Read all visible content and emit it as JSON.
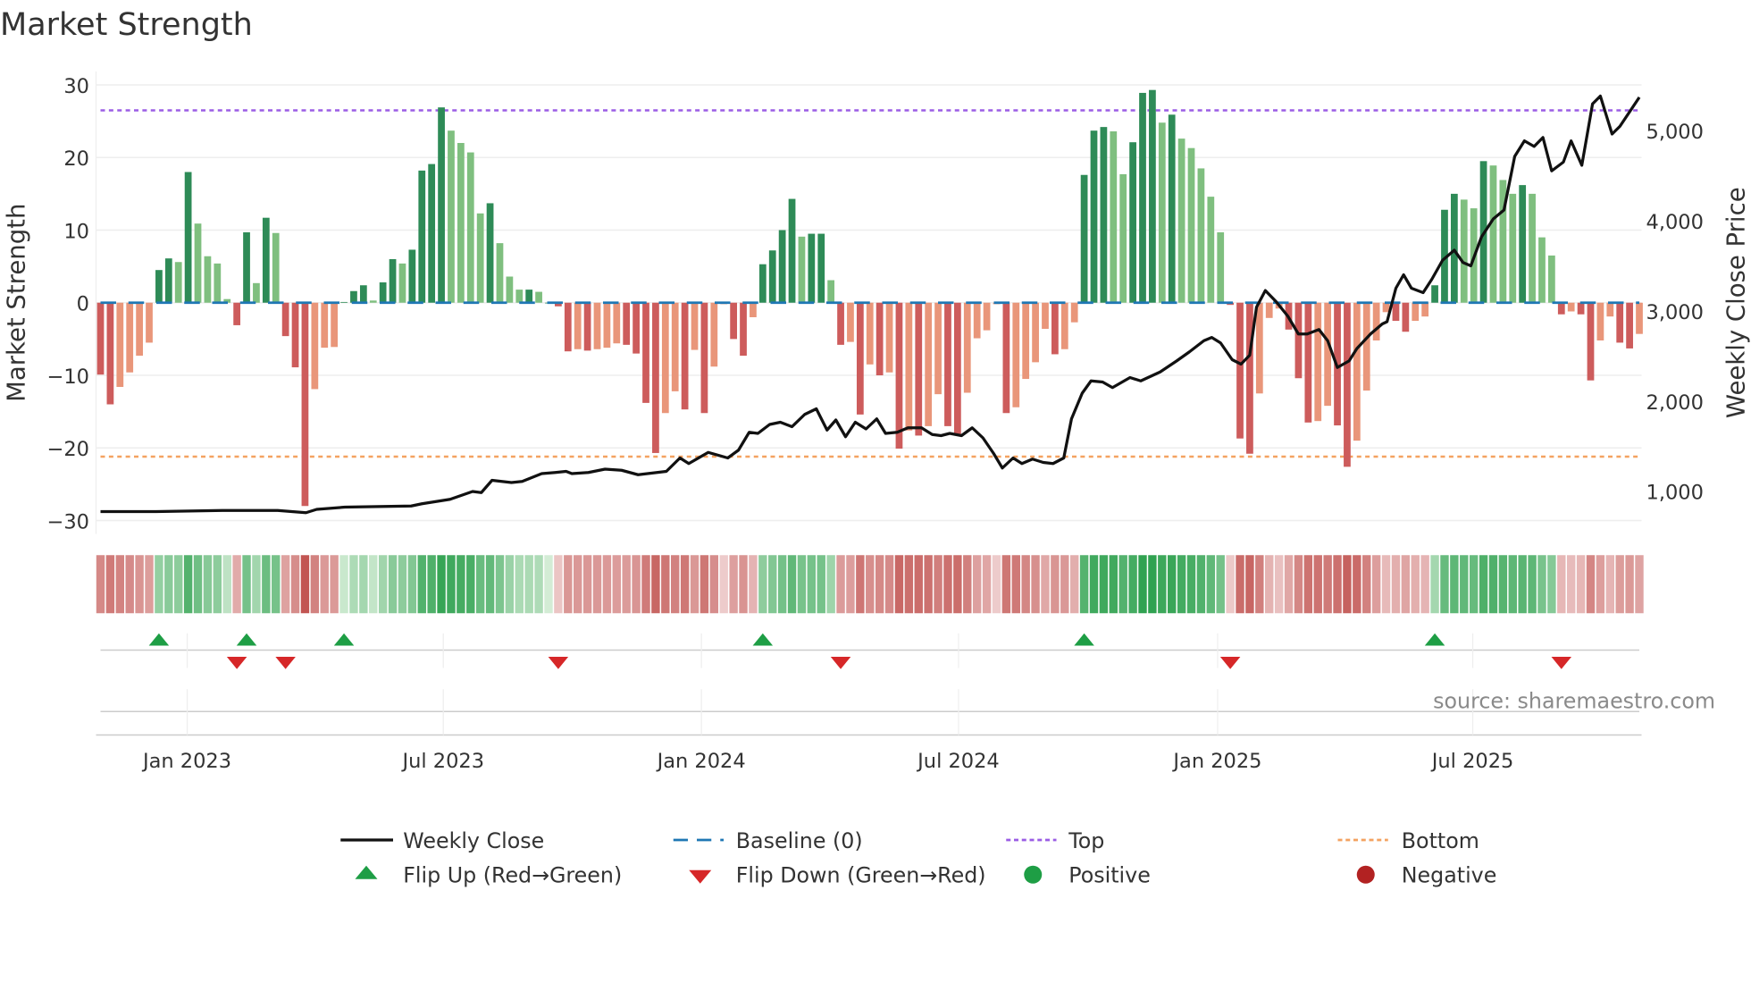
{
  "title": "Market Strength",
  "source": "source: sharemaestro.com",
  "colors": {
    "pos_strong": "#2e8b57",
    "pos_weak": "#7fbf7f",
    "neg_strong": "#cd5c5c",
    "neg_weak": "#e9967a",
    "line": "#111111",
    "baseline": "#1f77b4",
    "top": "#9b5de5",
    "bottom": "#f4a261",
    "flip_up": "#1e9e45",
    "flip_down": "#d62728",
    "positive": "#1e9e45",
    "negative": "#b22222"
  },
  "legend": {
    "weekly_close": "Weekly Close",
    "baseline": "Baseline (0)",
    "top": "Top",
    "bottom": "Bottom",
    "flip_up": "Flip Up (Red→Green)",
    "flip_down": "Flip Down (Green→Red)",
    "positive": "Positive",
    "negative": "Negative"
  },
  "chart_data": {
    "type": "bar",
    "title": "Market Strength",
    "ylabel": "Market Strength",
    "y2label": "Weekly Close Price",
    "ylim": [
      -30,
      30
    ],
    "y2lim": [
      678,
      5507
    ],
    "yticks": [
      "30",
      "20",
      "10",
      "0",
      "−10",
      "−20",
      "−30"
    ],
    "ytick_values": [
      30,
      20,
      10,
      0,
      -10,
      -20,
      -30
    ],
    "y2ticks": [
      "1,000",
      "2,000",
      "3,000",
      "4,000",
      "5,000"
    ],
    "y2tick_values": [
      1000,
      2000,
      3000,
      4000,
      5000
    ],
    "xticks": [
      {
        "label": "Jan 2023",
        "week": 8.9
      },
      {
        "label": "Jul 2023",
        "week": 35.2
      },
      {
        "label": "Jan 2024",
        "week": 61.7
      },
      {
        "label": "Jul 2024",
        "week": 88.1
      },
      {
        "label": "Jan 2025",
        "week": 114.7
      },
      {
        "label": "Jul 2025",
        "week": 140.9
      }
    ],
    "top_level": 26.5,
    "bottom_level": -21.2,
    "baseline": 0,
    "strength": [
      -9.9,
      -14,
      -11.6,
      -9.6,
      -7.3,
      -5.5,
      4.5,
      6.1,
      5.6,
      18,
      10.9,
      6.4,
      5.4,
      0.5,
      -3.1,
      9.7,
      2.7,
      11.7,
      9.6,
      -4.6,
      -8.9,
      -28,
      -11.9,
      -6.2,
      -6.1,
      0.1,
      1.6,
      2.4,
      0.3,
      2.8,
      6,
      5.4,
      7.3,
      18.2,
      19.1,
      26.9,
      23.7,
      22,
      20.7,
      12.3,
      13.7,
      8.2,
      3.6,
      1.8,
      1.8,
      1.5,
      0,
      -0.5,
      -6.7,
      -6.4,
      -6.6,
      -6.4,
      -6.2,
      -5.6,
      -5.8,
      -7,
      -13.8,
      -20.7,
      -15.2,
      -12.2,
      -14.7,
      -6.5,
      -15.2,
      -8.8,
      -0.2,
      -5,
      -7.3,
      -2,
      5.3,
      7.2,
      10,
      14.3,
      9.1,
      9.5,
      9.5,
      3.1,
      -5.8,
      -5.4,
      -15.4,
      -8.5,
      -10,
      -9.6,
      -20.1,
      -17.6,
      -18.3,
      -17,
      -12.6,
      -17,
      -18.2,
      -12.4,
      -4.9,
      -3.8,
      -0.2,
      -15.2,
      -14.4,
      -10.5,
      -8.2,
      -3.6,
      -7.1,
      -6.4,
      -2.7,
      17.6,
      23.7,
      24.2,
      23.6,
      17.7,
      22.1,
      28.9,
      29.3,
      24.8,
      25.9,
      22.6,
      21.3,
      18.5,
      14.6,
      9.7,
      -0.3,
      -18.7,
      -20.8,
      -12.5,
      -2.1,
      -0.8,
      -3.7,
      -10.4,
      -16.5,
      -16.3,
      -14.2,
      -16.9,
      -22.6,
      -19,
      -12.1,
      -5.2,
      -1.3,
      -2.5,
      -4,
      -2.5,
      -1.9,
      2.4,
      12.8,
      15,
      14.2,
      13,
      19.5,
      18.9,
      16.9,
      15,
      16.2,
      15,
      9,
      6.5,
      -1.6,
      -1.2,
      -1.6,
      -10.7,
      -5.2,
      -1.9,
      -5.5,
      -6.3,
      -4.3
    ],
    "weekly_close": [
      [
        0,
        777
      ],
      [
        5.7,
        777
      ],
      [
        12.5,
        790
      ],
      [
        18.2,
        790
      ],
      [
        21.1,
        765
      ],
      [
        22.2,
        802
      ],
      [
        25.1,
        827
      ],
      [
        31.9,
        839
      ],
      [
        33,
        864
      ],
      [
        35.9,
        913
      ],
      [
        38.2,
        1000
      ],
      [
        39.1,
        988
      ],
      [
        40.2,
        1124
      ],
      [
        42.2,
        1099
      ],
      [
        43.3,
        1111
      ],
      [
        45.3,
        1198
      ],
      [
        46.7,
        1210
      ],
      [
        47.8,
        1223
      ],
      [
        48.4,
        1198
      ],
      [
        50.1,
        1210
      ],
      [
        51.8,
        1248
      ],
      [
        53.5,
        1235
      ],
      [
        55.2,
        1186
      ],
      [
        58.1,
        1223
      ],
      [
        59.5,
        1371
      ],
      [
        60.4,
        1310
      ],
      [
        62.4,
        1433
      ],
      [
        64.4,
        1371
      ],
      [
        65.5,
        1458
      ],
      [
        66.6,
        1656
      ],
      [
        67.5,
        1644
      ],
      [
        68.7,
        1743
      ],
      [
        69.8,
        1768
      ],
      [
        71,
        1718
      ],
      [
        72.3,
        1854
      ],
      [
        73.5,
        1916
      ],
      [
        74.6,
        1681
      ],
      [
        75.5,
        1792
      ],
      [
        76.5,
        1607
      ],
      [
        77.5,
        1768
      ],
      [
        78.6,
        1693
      ],
      [
        79.7,
        1805
      ],
      [
        80.6,
        1644
      ],
      [
        81.8,
        1656
      ],
      [
        82.9,
        1706
      ],
      [
        84.3,
        1706
      ],
      [
        85.4,
        1631
      ],
      [
        86.3,
        1619
      ],
      [
        87.2,
        1644
      ],
      [
        88.4,
        1619
      ],
      [
        89.5,
        1706
      ],
      [
        90.6,
        1594
      ],
      [
        91.7,
        1421
      ],
      [
        92.6,
        1260
      ],
      [
        93.7,
        1371
      ],
      [
        94.6,
        1310
      ],
      [
        95.7,
        1359
      ],
      [
        96.8,
        1322
      ],
      [
        97.8,
        1310
      ],
      [
        98.9,
        1371
      ],
      [
        99.7,
        1805
      ],
      [
        100.8,
        2089
      ],
      [
        101.7,
        2226
      ],
      [
        102.9,
        2213
      ],
      [
        103.9,
        2151
      ],
      [
        105.7,
        2263
      ],
      [
        106.8,
        2226
      ],
      [
        108.8,
        2325
      ],
      [
        110.5,
        2448
      ],
      [
        111.8,
        2548
      ],
      [
        113.3,
        2671
      ],
      [
        114.1,
        2708
      ],
      [
        115,
        2647
      ],
      [
        116.2,
        2461
      ],
      [
        117.1,
        2411
      ],
      [
        118,
        2510
      ],
      [
        118.7,
        3043
      ],
      [
        119.6,
        3228
      ],
      [
        120.7,
        3105
      ],
      [
        121.9,
        2944
      ],
      [
        123,
        2746
      ],
      [
        123.9,
        2746
      ],
      [
        125.1,
        2795
      ],
      [
        126,
        2671
      ],
      [
        127,
        2374
      ],
      [
        128.2,
        2448
      ],
      [
        129,
        2585
      ],
      [
        130.4,
        2746
      ],
      [
        131.6,
        2857
      ],
      [
        132.1,
        2882
      ],
      [
        133,
        3253
      ],
      [
        133.8,
        3402
      ],
      [
        134.6,
        3253
      ],
      [
        135.8,
        3204
      ],
      [
        136.7,
        3352
      ],
      [
        137.8,
        3563
      ],
      [
        139,
        3674
      ],
      [
        139.9,
        3538
      ],
      [
        140.7,
        3501
      ],
      [
        141.8,
        3823
      ],
      [
        143,
        4021
      ],
      [
        144.1,
        4120
      ],
      [
        145.2,
        4714
      ],
      [
        146.2,
        4887
      ],
      [
        147.2,
        4825
      ],
      [
        148.1,
        4924
      ],
      [
        149,
        4553
      ],
      [
        150.2,
        4652
      ],
      [
        151,
        4887
      ],
      [
        152.1,
        4615
      ],
      [
        153.2,
        5296
      ],
      [
        154,
        5383
      ],
      [
        155.2,
        4962
      ],
      [
        156,
        5048
      ],
      [
        158,
        5370
      ]
    ],
    "flip_up_weeks": [
      6,
      15,
      25,
      68,
      101,
      137
    ],
    "flip_down_weeks": [
      14,
      19,
      47,
      76,
      116,
      150
    ],
    "legend_position": "bottom"
  }
}
